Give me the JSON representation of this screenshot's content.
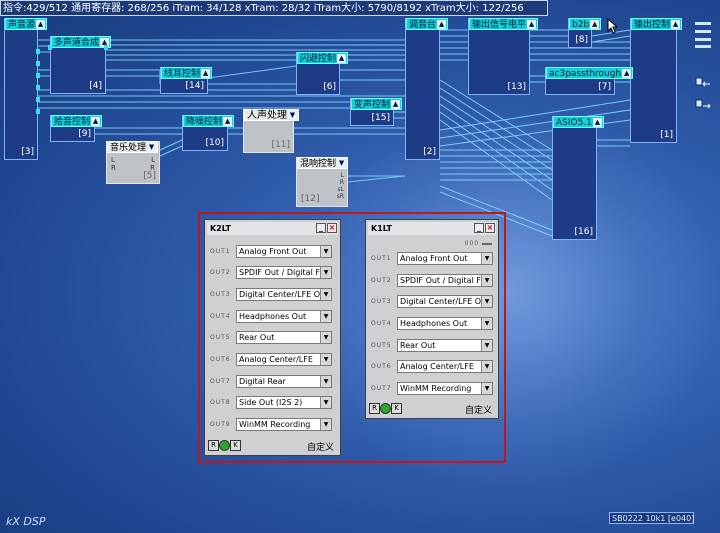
{
  "status": {
    "text": "指令:429/512 通用寄存器: 268/256 iTram: 34/128 xTram: 28/32 iTram大小: 5790/8192 xTram大小: 122/256"
  },
  "modules": [
    {
      "title": "声音源",
      "number": "[3]"
    },
    {
      "title": "多声道合成",
      "number": "[4]"
    },
    {
      "title": "线耳控制",
      "number": "[14]"
    },
    {
      "title": "闪避控制",
      "number": "[6]"
    },
    {
      "title": "调音台",
      "number": "[2]"
    },
    {
      "title": "输出信号电平",
      "number": "[13]"
    },
    {
      "title": "b2b",
      "number": "[8]"
    },
    {
      "title": "输出控制",
      "number": "[1]"
    },
    {
      "title": "ac3passthrough",
      "number": "[7]"
    },
    {
      "title": "拾音控制",
      "number": "[9]"
    },
    {
      "title": "音乐处理",
      "number": "[5]"
    },
    {
      "title": "降噪控制",
      "number": "[10]"
    },
    {
      "title": "人声处理",
      "number": "[11]"
    },
    {
      "title": "变声控制",
      "number": "[15]"
    },
    {
      "title": "混响控制",
      "number": "[12]"
    },
    {
      "title": "ASIO5.1",
      "number": "[16]"
    }
  ],
  "k2lt": {
    "title": "K2LT",
    "rows": [
      {
        "label": "OUT1",
        "value": "Analog Front Out"
      },
      {
        "label": "OUT2",
        "value": "SPDIF Out / Digital Fro"
      },
      {
        "label": "OUT3",
        "value": "Digital Center/LFE Out"
      },
      {
        "label": "OUT4",
        "value": "Headphones Out"
      },
      {
        "label": "OUT5",
        "value": "Rear Out"
      },
      {
        "label": "OUT6",
        "value": "Analog Center/LFE"
      },
      {
        "label": "OUT7",
        "value": "Digital Rear"
      },
      {
        "label": "OUT8",
        "value": "Side Out (I2S 2)"
      },
      {
        "label": "OUT9",
        "value": "WinMM Recording"
      }
    ],
    "footer": {
      "r": "R",
      "k": "K",
      "custom": "自定义"
    }
  },
  "k1lt": {
    "title": "K1LT",
    "meter": "000",
    "rows": [
      {
        "label": "OUT1",
        "value": "Analog Front Out"
      },
      {
        "label": "OUT2",
        "value": "SPDIF Out / Digital Fro"
      },
      {
        "label": "OUT3",
        "value": "Digital Center/LFE Out"
      },
      {
        "label": "OUT4",
        "value": "Headphones Out"
      },
      {
        "label": "OUT5",
        "value": "Rear Out"
      },
      {
        "label": "OUT6",
        "value": "Analog Center/LFE"
      },
      {
        "label": "OUT7",
        "value": "WinMM Recording"
      }
    ],
    "footer": {
      "r": "R",
      "k": "K",
      "custom": "自定义"
    }
  },
  "pins": {
    "l": "L",
    "r": "R",
    "sl": "sL",
    "sr": "sR"
  },
  "logo": "kX DSP",
  "version": "SB0222 10k1 [e040]",
  "colors": {
    "accent": "#12d0d8",
    "frame": "#c2161c",
    "background": "#2f5cab"
  }
}
